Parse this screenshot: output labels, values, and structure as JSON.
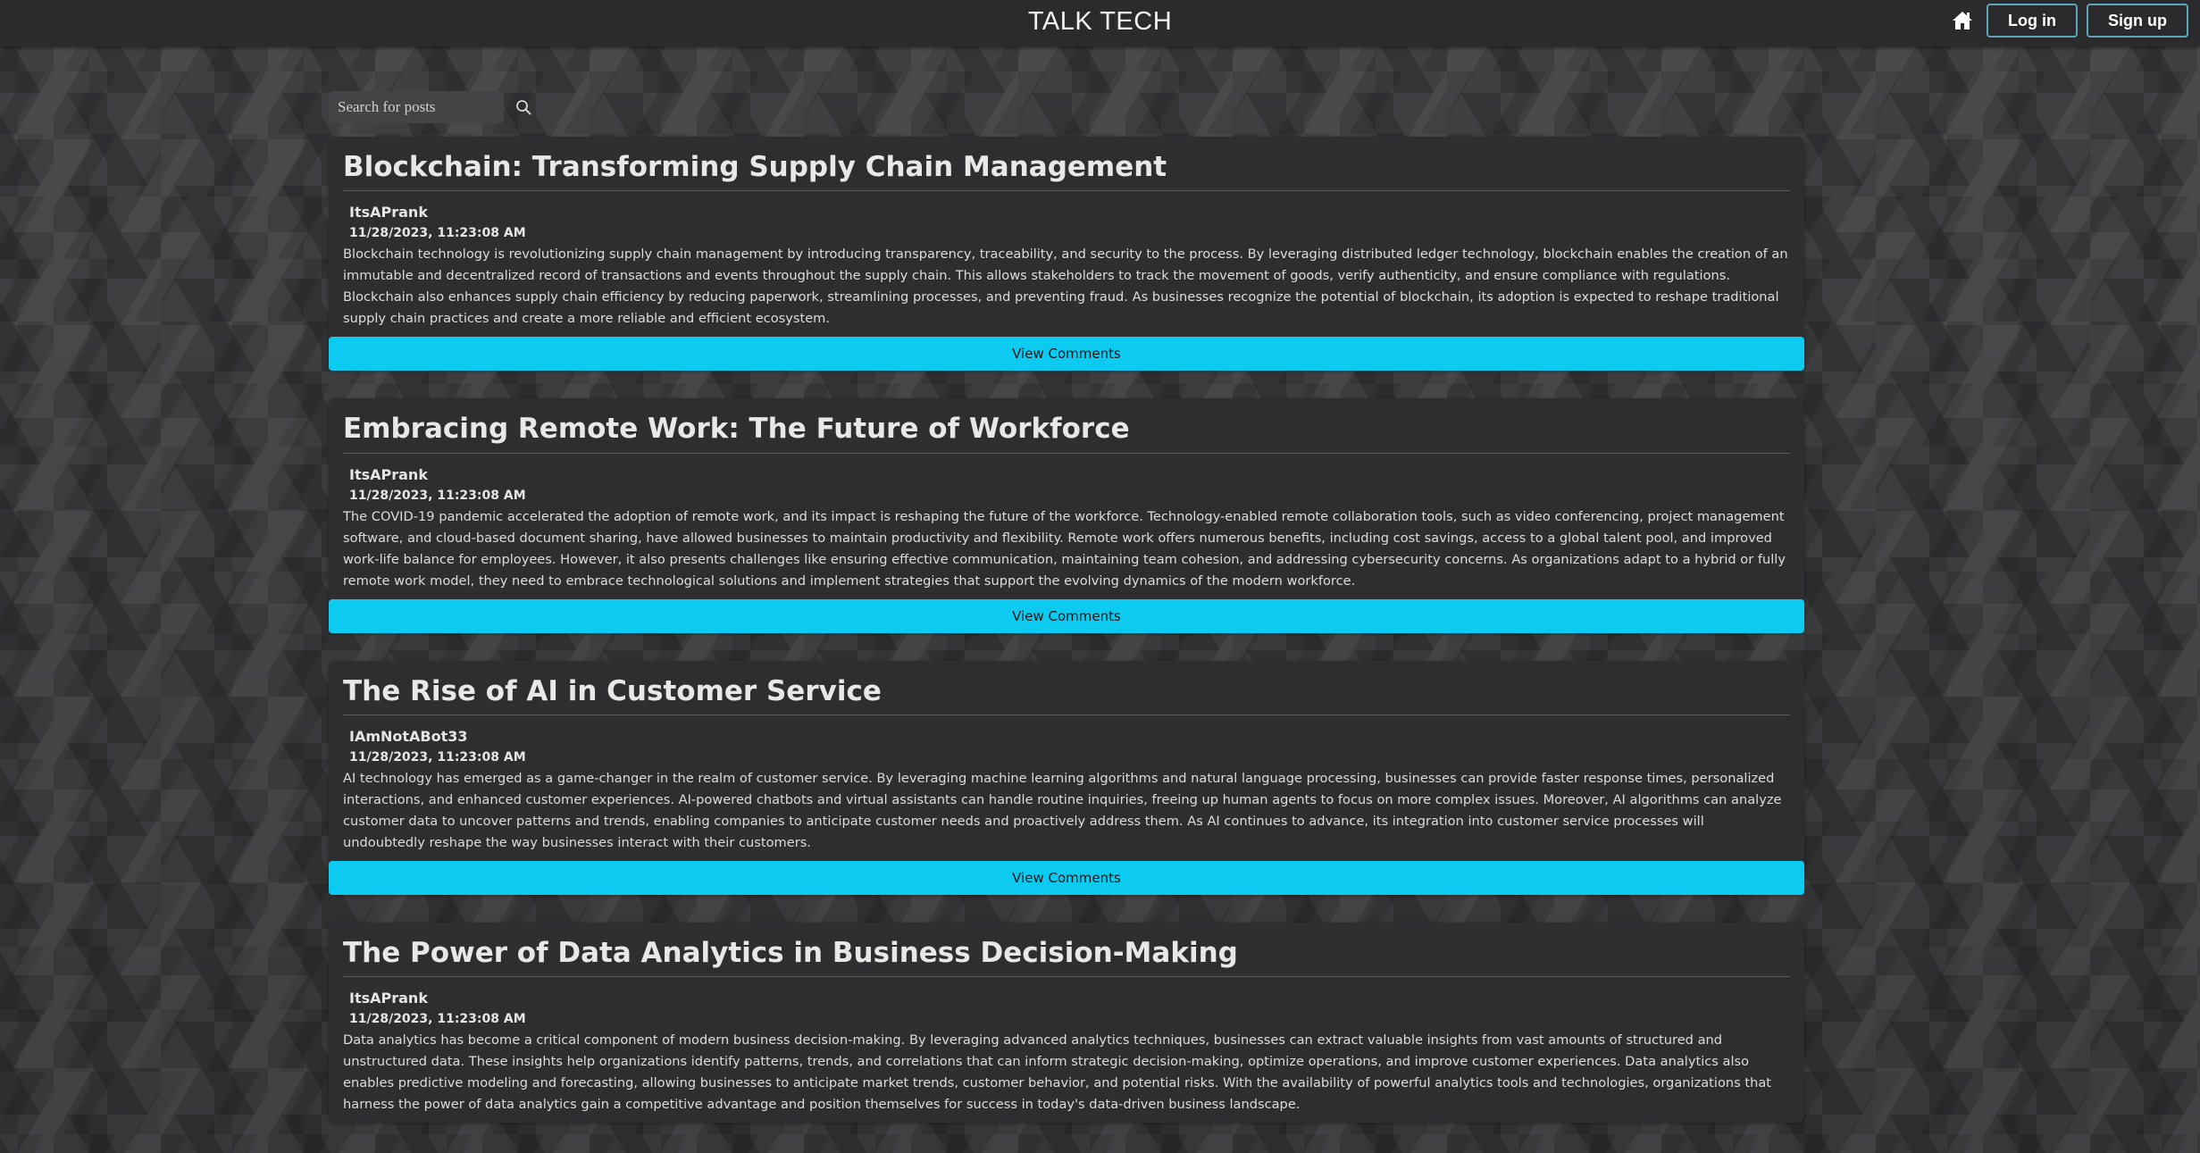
{
  "header": {
    "title": "TALK TECH",
    "home_icon": "home-icon",
    "login_label": "Log in",
    "signup_label": "Sign up"
  },
  "search": {
    "placeholder": "Search for posts",
    "value": "",
    "icon": "search-icon"
  },
  "accent_color": "#0dcaf0",
  "posts": [
    {
      "title": "Blockchain: Transforming Supply Chain Management",
      "author": "ItsAPrank",
      "date": "11/28/2023, 11:23:08 AM",
      "body": "Blockchain technology is revolutionizing supply chain management by introducing transparency, traceability, and security to the process. By leveraging distributed ledger technology, blockchain enables the creation of an immutable and decentralized record of transactions and events throughout the supply chain. This allows stakeholders to track the movement of goods, verify authenticity, and ensure compliance with regulations. Blockchain also enhances supply chain efficiency by reducing paperwork, streamlining processes, and preventing fraud. As businesses recognize the potential of blockchain, its adoption is expected to reshape traditional supply chain practices and create a more reliable and efficient ecosystem.",
      "comments_label": "View Comments"
    },
    {
      "title": "Embracing Remote Work: The Future of Workforce",
      "author": "ItsAPrank",
      "date": "11/28/2023, 11:23:08 AM",
      "body": "The COVID-19 pandemic accelerated the adoption of remote work, and its impact is reshaping the future of the workforce. Technology-enabled remote collaboration tools, such as video conferencing, project management software, and cloud-based document sharing, have allowed businesses to maintain productivity and flexibility. Remote work offers numerous benefits, including cost savings, access to a global talent pool, and improved work-life balance for employees. However, it also presents challenges like ensuring effective communication, maintaining team cohesion, and addressing cybersecurity concerns. As organizations adapt to a hybrid or fully remote work model, they need to embrace technological solutions and implement strategies that support the evolving dynamics of the modern workforce.",
      "comments_label": "View Comments"
    },
    {
      "title": "The Rise of AI in Customer Service",
      "author": "IAmNotABot33",
      "date": "11/28/2023, 11:23:08 AM",
      "body": "AI technology has emerged as a game-changer in the realm of customer service. By leveraging machine learning algorithms and natural language processing, businesses can provide faster response times, personalized interactions, and enhanced customer experiences. AI-powered chatbots and virtual assistants can handle routine inquiries, freeing up human agents to focus on more complex issues. Moreover, AI algorithms can analyze customer data to uncover patterns and trends, enabling companies to anticipate customer needs and proactively address them. As AI continues to advance, its integration into customer service processes will undoubtedly reshape the way businesses interact with their customers.",
      "comments_label": "View Comments"
    },
    {
      "title": "The Power of Data Analytics in Business Decision-Making",
      "author": "ItsAPrank",
      "date": "11/28/2023, 11:23:08 AM",
      "body": "Data analytics has become a critical component of modern business decision-making. By leveraging advanced analytics techniques, businesses can extract valuable insights from vast amounts of structured and unstructured data. These insights help organizations identify patterns, trends, and correlations that can inform strategic decision-making, optimize operations, and improve customer experiences. Data analytics also enables predictive modeling and forecasting, allowing businesses to anticipate market trends, customer behavior, and potential risks. With the availability of powerful analytics tools and technologies, organizations that harness the power of data analytics gain a competitive advantage and position themselves for success in today's data-driven business landscape."
    }
  ]
}
